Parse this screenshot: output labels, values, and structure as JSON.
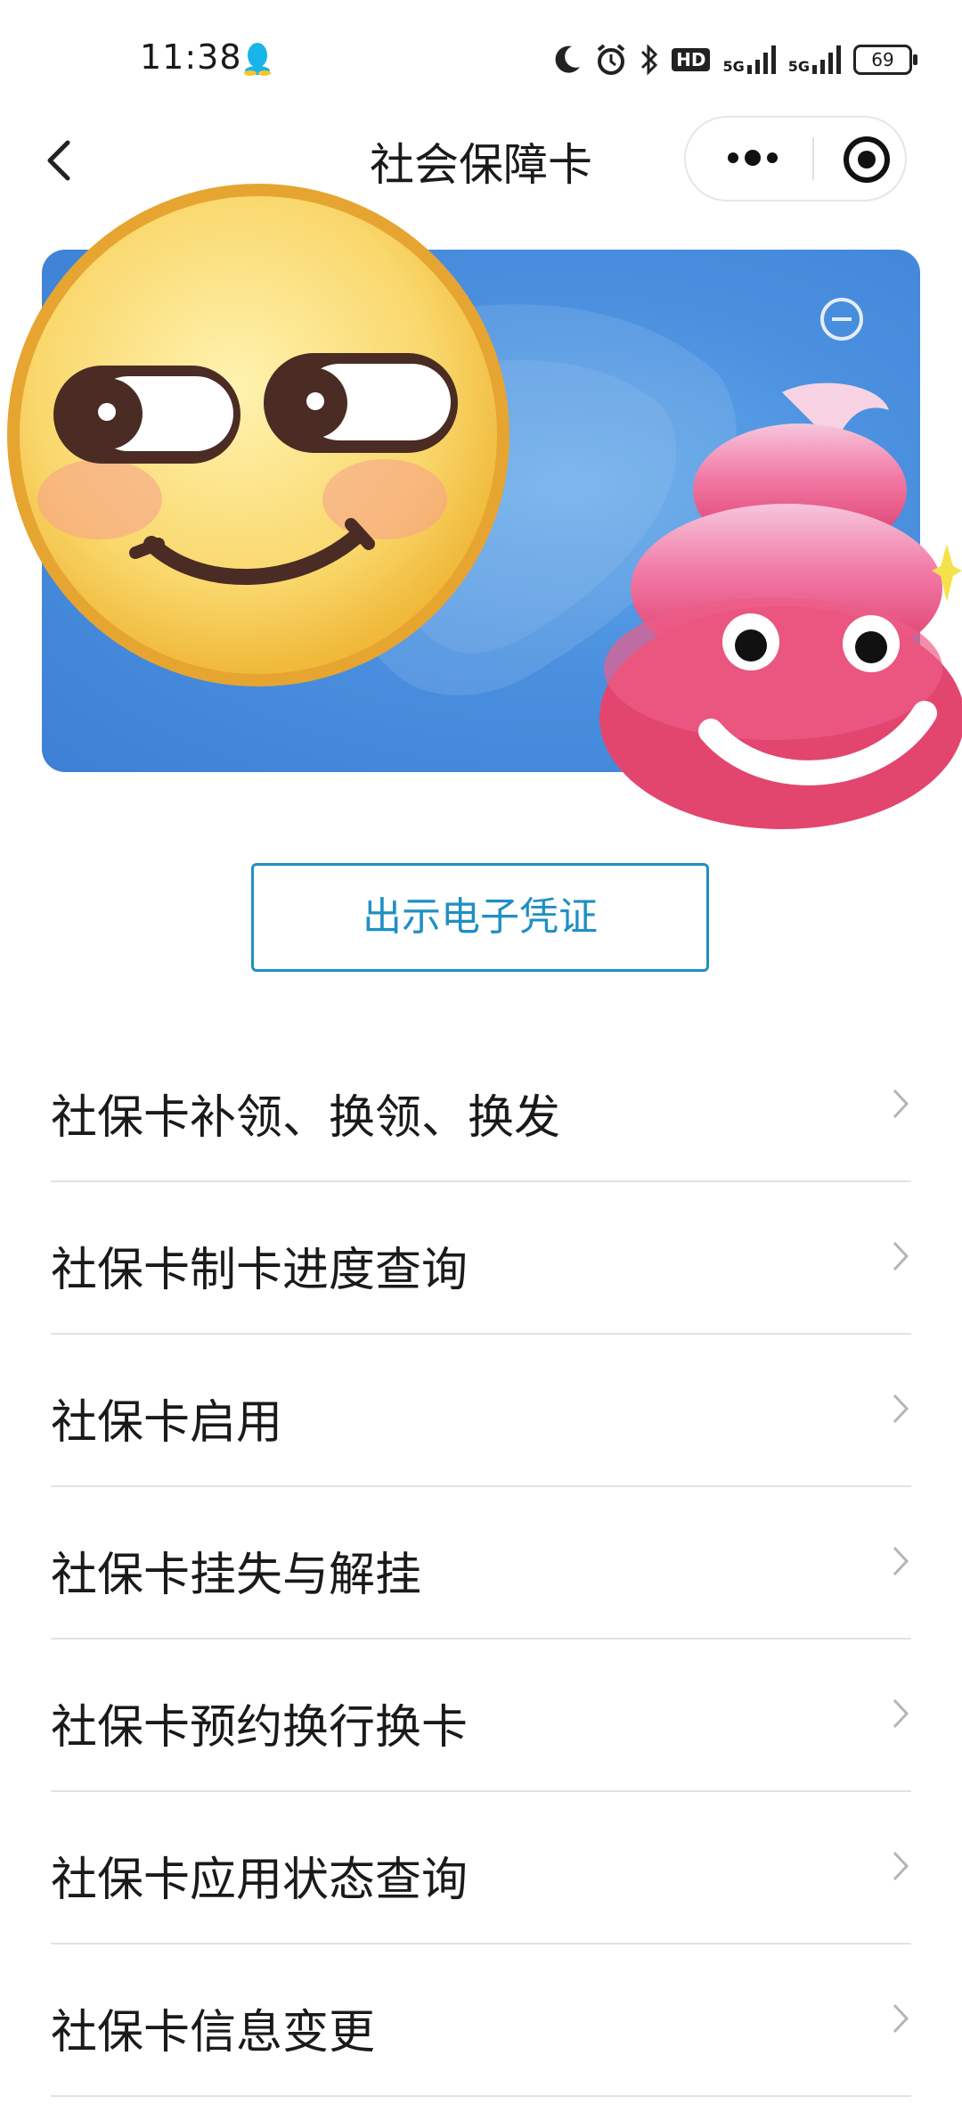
{
  "status_bar": {
    "time": "11:38",
    "battery": "69",
    "hd_label": "HD",
    "signal1_label": "5G",
    "signal2_label": "5G",
    "icons": [
      "moon-icon",
      "alarm-icon",
      "bluetooth-icon",
      "hd-icon",
      "signal-icon",
      "signal-icon",
      "battery-icon"
    ]
  },
  "nav": {
    "title": "社会保障卡",
    "back_icon": "back-arrow-icon",
    "more_icon": "more-dots-icon",
    "close_icon": "target-close-icon"
  },
  "card": {
    "background": "#4b90df",
    "minus_icon": "minus-circle-icon"
  },
  "stickers": [
    "smirk-emoji",
    "pink-poop-emoji"
  ],
  "voucher_button": {
    "label": "出示电子凭证",
    "color": "#1f8fc4"
  },
  "menu": [
    {
      "label": "社保卡补领、换领、换发"
    },
    {
      "label": "社保卡制卡进度查询"
    },
    {
      "label": "社保卡启用"
    },
    {
      "label": "社保卡挂失与解挂"
    },
    {
      "label": "社保卡预约换行换卡"
    },
    {
      "label": "社保卡应用状态查询"
    },
    {
      "label": "社保卡信息变更"
    }
  ]
}
